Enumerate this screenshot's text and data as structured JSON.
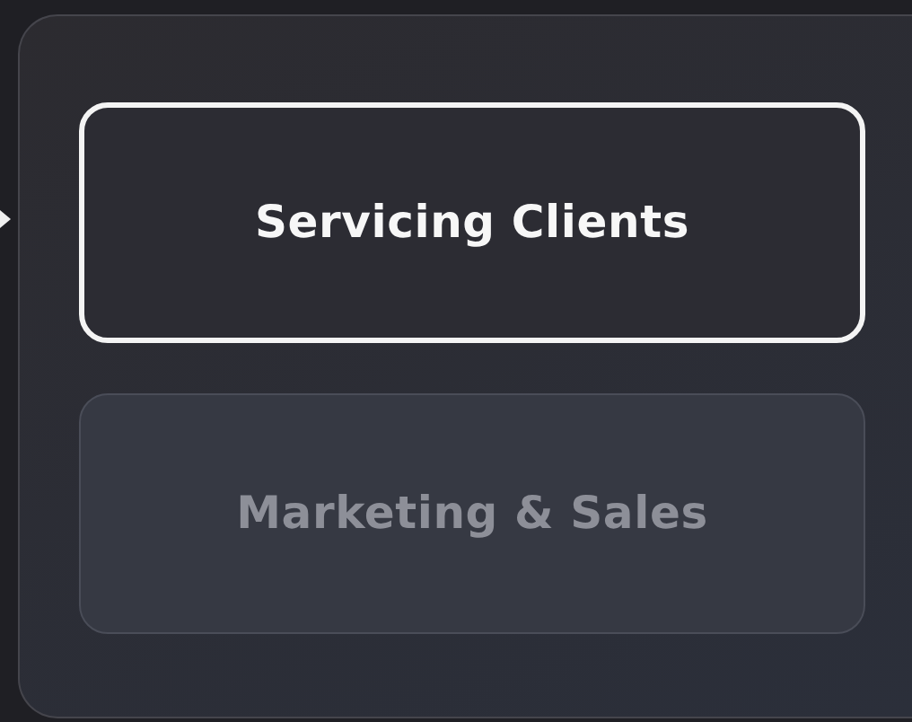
{
  "options": [
    {
      "label": "Servicing Clients",
      "selected": true
    },
    {
      "label": "Marketing & Sales",
      "selected": false
    }
  ]
}
